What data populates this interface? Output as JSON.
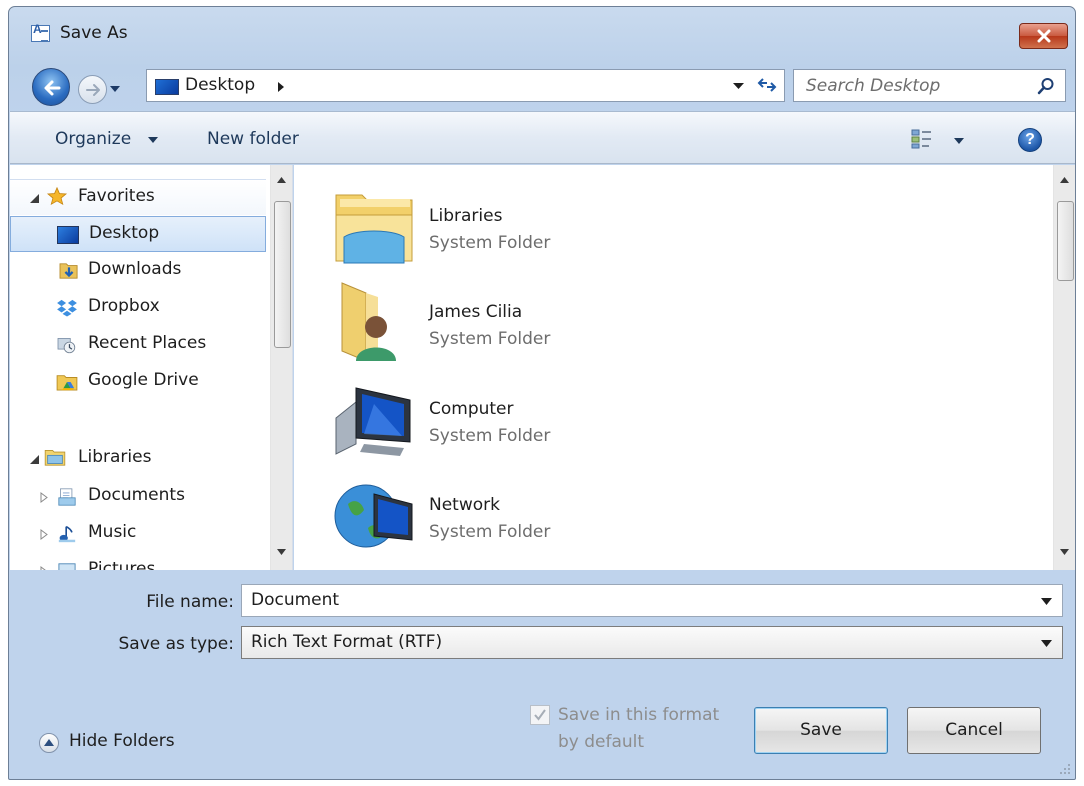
{
  "window": {
    "title": "Save As"
  },
  "address": {
    "location": "Desktop"
  },
  "search": {
    "placeholder": "Search Desktop"
  },
  "toolbar": {
    "organize_label": "Organize",
    "new_folder_label": "New folder"
  },
  "nav": {
    "favorites_label": "Favorites",
    "favorites": [
      {
        "label": "Desktop",
        "icon": "desktop-icon"
      },
      {
        "label": "Downloads",
        "icon": "downloads-icon"
      },
      {
        "label": "Dropbox",
        "icon": "dropbox-icon"
      },
      {
        "label": "Recent Places",
        "icon": "recent-places-icon"
      },
      {
        "label": "Google Drive",
        "icon": "google-drive-icon"
      }
    ],
    "libraries_label": "Libraries",
    "libraries": [
      {
        "label": "Documents",
        "icon": "documents-icon"
      },
      {
        "label": "Music",
        "icon": "music-icon"
      },
      {
        "label": "Pictures",
        "icon": "pictures-icon"
      }
    ]
  },
  "items": [
    {
      "name": "Libraries",
      "type": "System Folder",
      "icon": "libraries-folder-icon"
    },
    {
      "name": "James Cilia",
      "type": "System Folder",
      "icon": "user-folder-icon"
    },
    {
      "name": "Computer",
      "type": "System Folder",
      "icon": "computer-icon"
    },
    {
      "name": "Network",
      "type": "System Folder",
      "icon": "network-icon"
    }
  ],
  "form": {
    "file_name_label": "File name:",
    "file_name_value": "Document",
    "save_type_label": "Save as type:",
    "save_type_value": "Rich Text Format (RTF)"
  },
  "footer": {
    "hide_folders_label": "Hide Folders",
    "default_format_label_line1": "Save in this format",
    "default_format_label_line2": "by default",
    "save_label": "Save",
    "cancel_label": "Cancel"
  },
  "colors": {
    "close_button": "#c94a2c",
    "selection": "#cfe2f8",
    "chrome": "#bcd1ea"
  }
}
